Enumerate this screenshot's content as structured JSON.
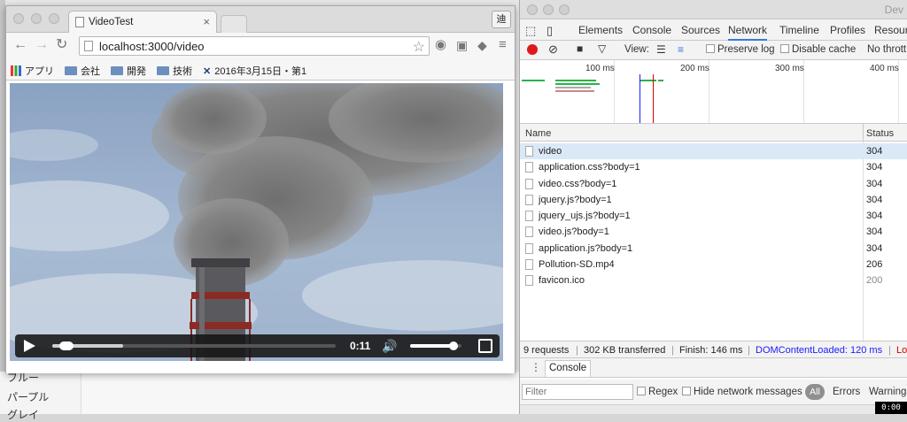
{
  "browser": {
    "tab_title": "VideoTest",
    "tab_close": "×",
    "user_button": "迪",
    "url": "localhost:3000/video",
    "bookmarks": [
      "アプリ",
      "会社",
      "開発",
      "技術",
      "2016年3月15日・第1"
    ]
  },
  "video": {
    "time": "0:11",
    "progress": 0.05,
    "buffered": 0.25,
    "volume": 0.85
  },
  "devtools": {
    "title": "Dev",
    "tabs": [
      "Elements",
      "Console",
      "Sources",
      "Network",
      "Timeline",
      "Profiles",
      "Resour"
    ],
    "active_tab": "Network",
    "toolbar": {
      "view_label": "View:",
      "preserve_log": "Preserve log",
      "disable_cache": "Disable cache",
      "throttle": "No thrott"
    },
    "overview_ticks": [
      "100 ms",
      "200 ms",
      "300 ms",
      "400 ms"
    ],
    "columns": {
      "name": "Name",
      "status": "Status"
    },
    "requests": [
      {
        "name": "video",
        "status": "304"
      },
      {
        "name": "application.css?body=1",
        "status": "304"
      },
      {
        "name": "video.css?body=1",
        "status": "304"
      },
      {
        "name": "jquery.js?body=1",
        "status": "304"
      },
      {
        "name": "jquery_ujs.js?body=1",
        "status": "304"
      },
      {
        "name": "video.js?body=1",
        "status": "304"
      },
      {
        "name": "application.js?body=1",
        "status": "304"
      },
      {
        "name": "Pollution-SD.mp4",
        "status": "206"
      },
      {
        "name": "favicon.ico",
        "status": "200"
      }
    ],
    "summary": {
      "requests": "9 requests",
      "transferred": "302 KB transferred",
      "finish": "Finish: 146 ms",
      "dcl": "DOMContentLoaded: 120 ms",
      "load": "Lo"
    },
    "console_tab": "Console",
    "filter_placeholder": "Filter",
    "regex": "Regex",
    "hide_network": "Hide network messages",
    "all": "All",
    "errors": "Errors",
    "warnings": "Warnings",
    "timer": "0:00"
  },
  "background": {
    "sidebar": [
      "ブルー",
      "パープル",
      "グレイ"
    ]
  },
  "colors": {
    "accent": "#3879d9",
    "dcl": "#1a1aff",
    "load": "#d10000",
    "record": "#e0181b"
  }
}
